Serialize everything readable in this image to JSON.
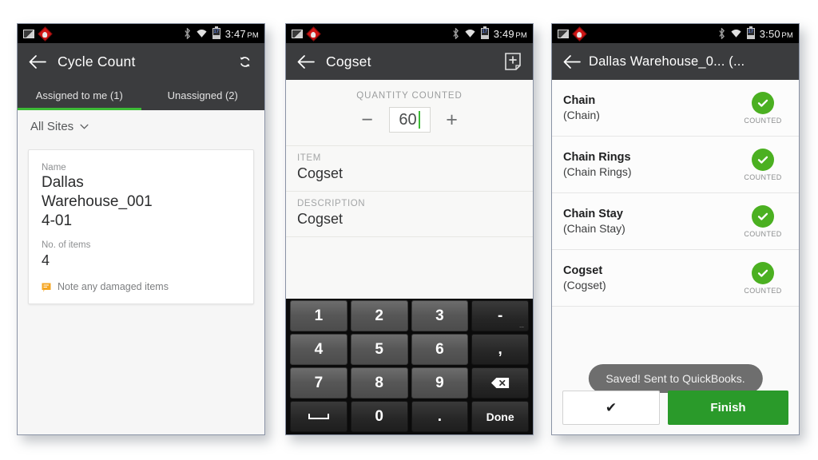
{
  "colors": {
    "accent_green": "#3dbb36",
    "badge_green": "#4bb021",
    "finish_green": "#2a9a2a",
    "action_bar": "#3b3c3e",
    "status_bar": "#000000",
    "note_orange": "#f5a623"
  },
  "phone1": {
    "status": {
      "time": "3:47",
      "meridiem": "PM",
      "battery_level": "17",
      "icons": [
        "photo-icon",
        "alert-icon",
        "bluetooth-icon",
        "wifi-icon",
        "battery-icon"
      ]
    },
    "actionbar": {
      "back": "back-arrow-icon",
      "title": "Cycle Count",
      "action": "refresh-icon"
    },
    "tabs": [
      {
        "label": "Assigned to me (1)",
        "active": true
      },
      {
        "label": "Unassigned (2)",
        "active": false
      }
    ],
    "filter": {
      "label": "All Sites",
      "icon": "chevron-down-icon"
    },
    "card": {
      "name_label": "Name",
      "name_value_line1": "Dallas",
      "name_value_line2": "Warehouse_001",
      "name_value_line3": "4-01",
      "items_label": "No. of items",
      "items_value": "4",
      "note_icon": "note-flag-icon",
      "note_text": "Note any damaged items"
    }
  },
  "phone2": {
    "status": {
      "time": "3:49",
      "meridiem": "PM",
      "battery_level": "17"
    },
    "actionbar": {
      "back": "back-arrow-icon",
      "title": "Cogset",
      "action": "add-note-icon"
    },
    "quantity": {
      "caption": "QUANTITY COUNTED",
      "minus": "−",
      "plus": "+",
      "value": "60"
    },
    "fields": [
      {
        "label": "ITEM",
        "value": "Cogset"
      },
      {
        "label": "DESCRIPTION",
        "value": "Cogset"
      }
    ],
    "keyboard": {
      "rows": [
        [
          {
            "label": "1",
            "dark": false
          },
          {
            "label": "2",
            "dark": false
          },
          {
            "label": "3",
            "dark": false
          },
          {
            "label": "-",
            "dark": true,
            "sub": "..."
          }
        ],
        [
          {
            "label": "4",
            "dark": false
          },
          {
            "label": "5",
            "dark": false
          },
          {
            "label": "6",
            "dark": false
          },
          {
            "label": ",",
            "dark": true
          }
        ],
        [
          {
            "label": "7",
            "dark": false
          },
          {
            "label": "8",
            "dark": false
          },
          {
            "label": "9",
            "dark": false
          },
          {
            "label": "",
            "dark": true,
            "icon": "backspace-icon"
          }
        ],
        [
          {
            "label": "",
            "dark": true,
            "icon": "space-icon"
          },
          {
            "label": "0",
            "dark": true
          },
          {
            "label": ".",
            "dark": true
          },
          {
            "label": "Done",
            "dark": true
          }
        ]
      ]
    }
  },
  "phone3": {
    "status": {
      "time": "3:50",
      "meridiem": "PM",
      "battery_level": "17"
    },
    "actionbar": {
      "back": "back-arrow-icon",
      "title": "Dallas Warehouse_0... (..."
    },
    "items": [
      {
        "name": "Chain",
        "sub": "(Chain)",
        "status": "COUNTED",
        "icon": "check-circle-icon"
      },
      {
        "name": "Chain Rings",
        "sub": "(Chain Rings)",
        "status": "COUNTED",
        "icon": "check-circle-icon"
      },
      {
        "name": "Chain Stay",
        "sub": "(Chain Stay)",
        "status": "COUNTED",
        "icon": "check-circle-icon"
      },
      {
        "name": "Cogset",
        "sub": "(Cogset)",
        "status": "COUNTED",
        "icon": "check-circle-icon"
      }
    ],
    "toast": "Saved! Sent to QuickBooks.",
    "buttons": {
      "check": "✔",
      "finish": "Finish"
    }
  }
}
